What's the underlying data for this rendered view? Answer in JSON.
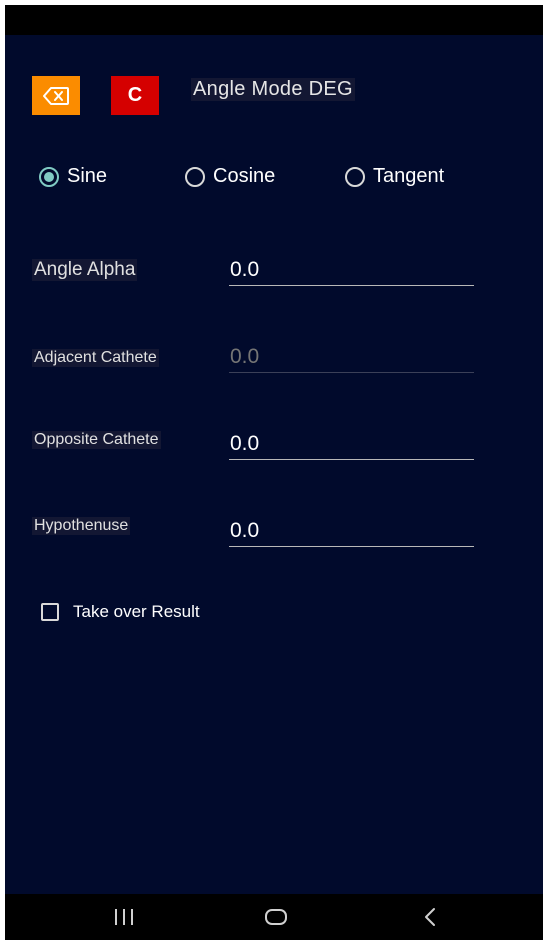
{
  "toolbar": {
    "backspace_icon": "backspace-icon",
    "clear_label": "C",
    "angle_mode_label": "Angle Mode DEG"
  },
  "function_selector": {
    "options": [
      {
        "label": "Sine",
        "checked": true
      },
      {
        "label": "Cosine",
        "checked": false
      },
      {
        "label": "Tangent",
        "checked": false
      }
    ]
  },
  "fields": {
    "angle_alpha": {
      "label": "Angle Alpha",
      "value": "0.0",
      "enabled": true
    },
    "adjacent_cathete": {
      "label": "Adjacent Cathete",
      "placeholder": "0.0",
      "enabled": false
    },
    "opposite_cathete": {
      "label": "Opposite Cathete",
      "value": "0.0",
      "enabled": true
    },
    "hypothenuse": {
      "label": "Hypothenuse",
      "value": "0.0",
      "enabled": true
    }
  },
  "take_over_result": {
    "label": "Take over Result",
    "checked": false
  },
  "navigation": {
    "recents_icon": "recents-icon",
    "home_icon": "home-icon",
    "back_icon": "back-icon"
  },
  "colors": {
    "background": "#010a2c",
    "backspace_button": "#fb8c00",
    "clear_button": "#d50000",
    "radio_accent": "#80cbc4"
  }
}
